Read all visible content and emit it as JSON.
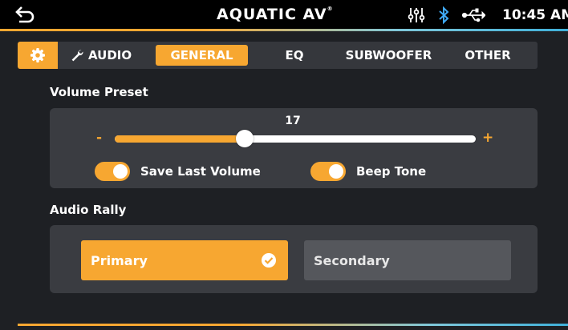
{
  "header": {
    "brand": "AQUATIC AV",
    "brand_mark": "®",
    "time": "10:45 AM",
    "icons": [
      "back-arrow-icon",
      "equalizer-icon",
      "bluetooth-icon",
      "usb-icon"
    ]
  },
  "tabs": {
    "settings_icon": "gear-icon",
    "audio_label": "AUDIO",
    "audio_icon": "wrench-icon",
    "items": [
      {
        "label": "GENERAL",
        "active": true
      },
      {
        "label": "EQ",
        "active": false
      },
      {
        "label": "SUBWOOFER",
        "active": false
      },
      {
        "label": "OTHER",
        "active": false
      }
    ]
  },
  "volume_preset": {
    "title": "Volume Preset",
    "value": "17",
    "fraction": 0.36,
    "minus_label": "-",
    "plus_label": "+",
    "save_last_volume": {
      "label": "Save Last Volume",
      "on": true
    },
    "beep_tone": {
      "label": "Beep Tone",
      "on": true
    }
  },
  "audio_rally": {
    "title": "Audio Rally",
    "primary_label": "Primary",
    "secondary_label": "Secondary",
    "selected": "Primary"
  },
  "colors": {
    "accent": "#f7a731",
    "panel": "#3a3c41",
    "background": "#1e2024",
    "bluetooth": "#3fa9f5"
  }
}
